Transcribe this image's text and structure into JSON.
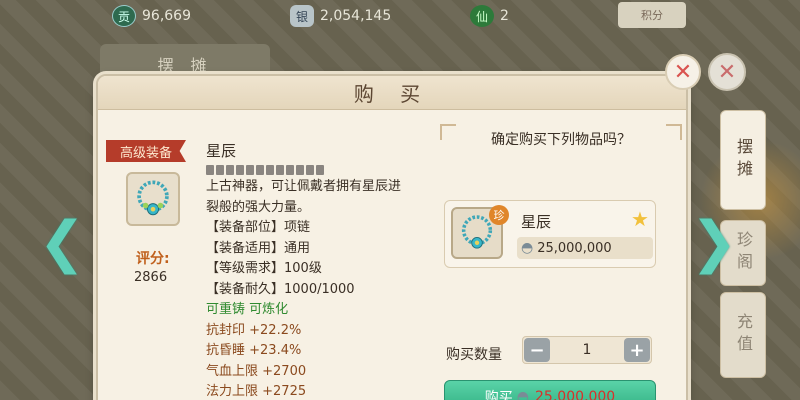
{
  "topbar": {
    "res1": {
      "icon": "contribution-icon",
      "glyph": "贡",
      "value": "96,669"
    },
    "res2": {
      "icon": "silver-ingot-icon",
      "glyph": "银",
      "value": "2,054,145"
    },
    "res3": {
      "icon": "green-coin-icon",
      "glyph": "仙",
      "value": "2"
    },
    "mini_button": "积分"
  },
  "background": {
    "back_tab": "摆 摊"
  },
  "side_tabs": {
    "stall": "摆摊",
    "goods": "珍阁",
    "recharge": "充值"
  },
  "dialog": {
    "title": "购 买",
    "left": {
      "grade_tag": "高级装备",
      "score_label": "评分:",
      "score_value": "2866",
      "item_name": "星辰",
      "lines": [
        "上古神器，可让佩戴者拥有星辰进",
        "裂般的强大力量。",
        "【装备部位】项链",
        "【装备适用】通用",
        "【等级需求】100级",
        "【装备耐久】1000/1000"
      ],
      "special": "可重铸 可炼化",
      "stats": [
        "抗封印 +22.2%",
        "抗昏睡 +23.4%",
        "气血上限 +2700",
        "法力上限 +2725"
      ]
    },
    "right": {
      "confirm_question": "确定购买下列物品吗？",
      "card_name": "星辰",
      "rare_badge": "珍",
      "card_price": "25,000,000",
      "qty_label": "购买数量",
      "qty_value": "1",
      "buy_label": "购买",
      "buy_price": "25,000,000"
    }
  },
  "colors": {
    "accent_green": "#2fae80",
    "grade_red": "#b53c2a",
    "price_red": "#d9302a",
    "stat_brown": "#8b4a1e"
  }
}
